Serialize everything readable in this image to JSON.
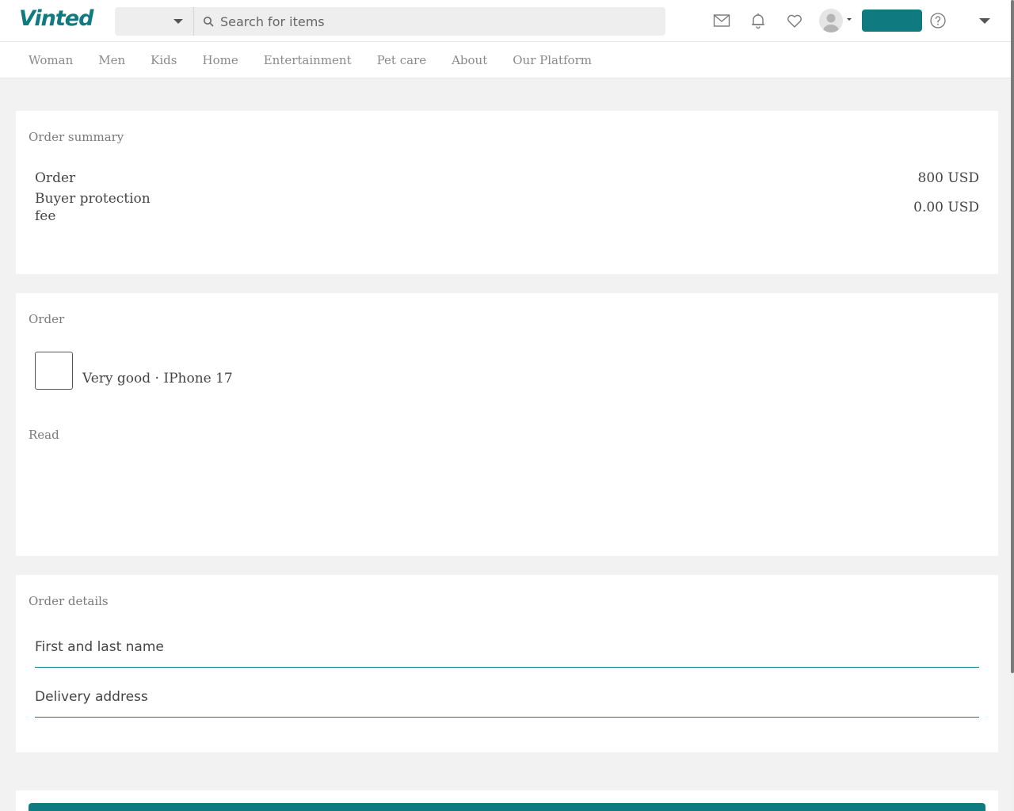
{
  "header": {
    "logo": "Vinted",
    "category_select_value": "",
    "search_placeholder": "Search for items",
    "sell_button_label": ""
  },
  "nav": {
    "items": [
      "Woman",
      "Men",
      "Kids",
      "Home",
      "Entertainment",
      "Pet care",
      "About",
      "Our Platform"
    ]
  },
  "summary": {
    "title": "Order summary",
    "rows": [
      {
        "label": "Order",
        "value": "800 USD"
      },
      {
        "label": "Buyer protection\nfee",
        "value": "0.00 USD"
      }
    ]
  },
  "order": {
    "title": "Order",
    "item_text": "Very good · IPhone 17",
    "read_label": "Read"
  },
  "details": {
    "title": "Order details",
    "name_placeholder": "First and last name",
    "address_placeholder": "Delivery address"
  },
  "pay": {
    "button_label": ""
  },
  "colors": {
    "brand": "#0f7b80",
    "background": "#f2f2f2"
  }
}
